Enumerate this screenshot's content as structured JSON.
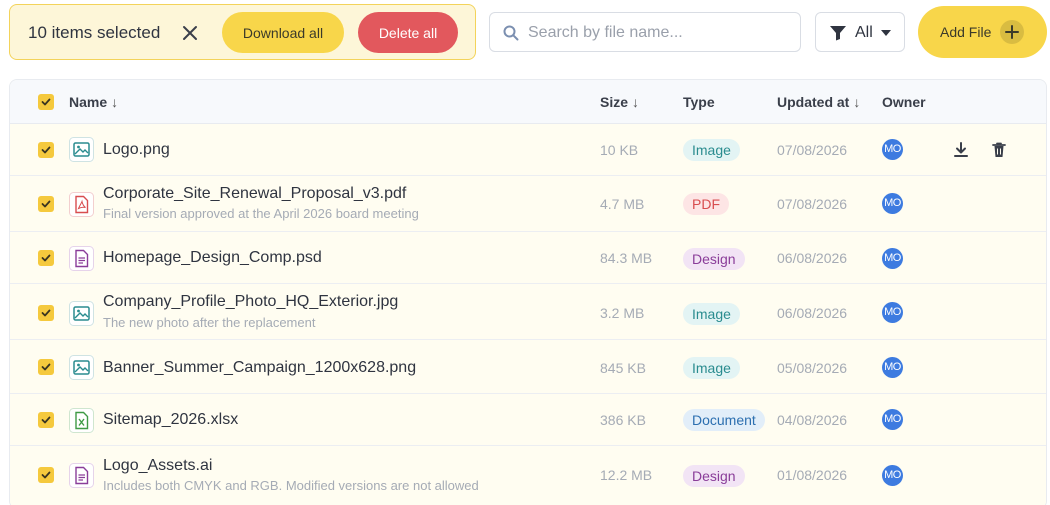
{
  "toolbar": {
    "selection_text": "10 items selected",
    "download_label": "Download all",
    "delete_label": "Delete all",
    "search_placeholder": "Search by file name...",
    "filter_value": "All",
    "add_label": "Add File"
  },
  "table": {
    "columns": {
      "name": "Name",
      "name_sort": "↓",
      "size": "Size",
      "size_sort": "↓",
      "type": "Type",
      "updated": "Updated at",
      "updated_sort": "↓",
      "owner": "Owner"
    },
    "rows": [
      {
        "name": "Logo.png",
        "description": "",
        "size": "10 KB",
        "type": "Image",
        "updated": "07/08/2026",
        "owner": "MO",
        "icon": "image-file-icon"
      },
      {
        "name": "Corporate_Site_Renewal_Proposal_v3.pdf",
        "description": "Final version approved at the April 2026 board meeting",
        "size": "4.7 MB",
        "type": "PDF",
        "updated": "07/08/2026",
        "owner": "MO",
        "icon": "pdf-file-icon"
      },
      {
        "name": "Homepage_Design_Comp.psd",
        "description": "",
        "size": "84.3 MB",
        "type": "Design",
        "updated": "06/08/2026",
        "owner": "MO",
        "icon": "design-file-icon"
      },
      {
        "name": "Company_Profile_Photo_HQ_Exterior.jpg",
        "description": "The new photo after the replacement",
        "size": "3.2 MB",
        "type": "Image",
        "updated": "06/08/2026",
        "owner": "MO",
        "icon": "image-file-icon"
      },
      {
        "name": "Banner_Summer_Campaign_1200x628.png",
        "description": "",
        "size": "845 KB",
        "type": "Image",
        "updated": "05/08/2026",
        "owner": "MO",
        "icon": "image-file-icon"
      },
      {
        "name": "Sitemap_2026.xlsx",
        "description": "",
        "size": "386 KB",
        "type": "Document",
        "updated": "04/08/2026",
        "owner": "MO",
        "icon": "spreadsheet-file-icon"
      },
      {
        "name": "Logo_Assets.ai",
        "description": "Includes both CMYK and RGB. Modified versions are not allowed",
        "size": "12.2 MB",
        "type": "Design",
        "updated": "01/08/2026",
        "owner": "MO",
        "icon": "design-file-icon"
      }
    ]
  }
}
